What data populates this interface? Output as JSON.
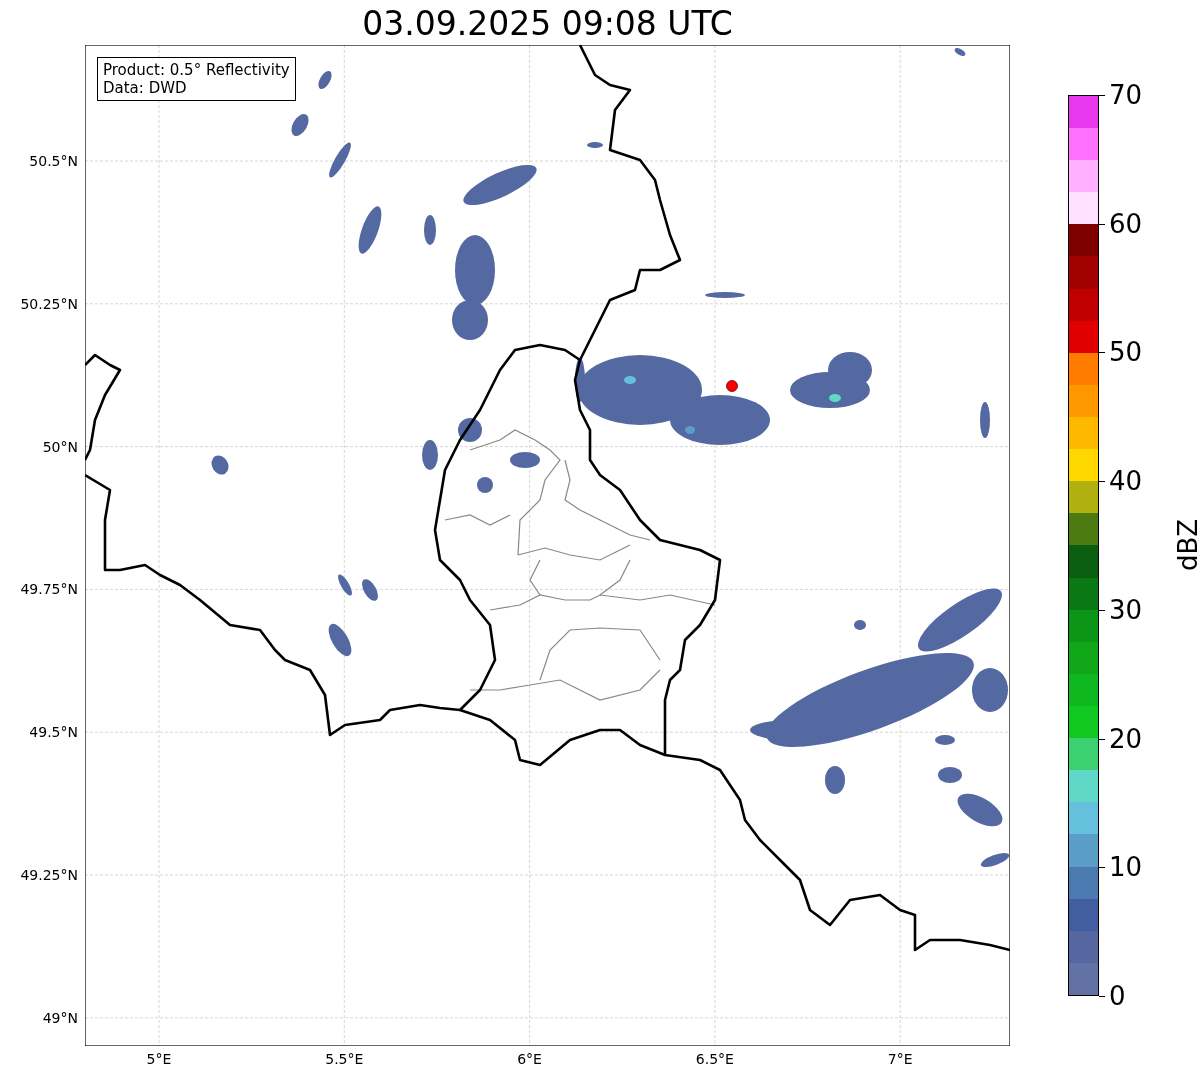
{
  "title": "03.09.2025 09:08 UTC",
  "info_box": [
    "Product: 0.5° Reflectivity",
    "Data: DWD"
  ],
  "y_ticks": [
    "50.5°N",
    "50.25°N",
    "50°N",
    "49.75°N",
    "49.5°N",
    "49.25°N",
    "49°N"
  ],
  "x_ticks": [
    "5°E",
    "5.5°E",
    "6°E",
    "6.5°E",
    "7°E"
  ],
  "colorbar": {
    "label": "dBZ",
    "ticks": [
      "70",
      "60",
      "50",
      "40",
      "30",
      "20",
      "10",
      "0"
    ],
    "segments": [
      {
        "color": "#6272a4"
      },
      {
        "color": "#5566a0"
      },
      {
        "color": "#435ea0"
      },
      {
        "color": "#4a7ab0"
      },
      {
        "color": "#5a9ec8"
      },
      {
        "color": "#64c0dc"
      },
      {
        "color": "#60d8c8"
      },
      {
        "color": "#3cd070"
      },
      {
        "color": "#10c820"
      },
      {
        "color": "#10b820"
      },
      {
        "color": "#10a818"
      },
      {
        "color": "#0c9618"
      },
      {
        "color": "#0a7814"
      },
      {
        "color": "#0a5e10"
      },
      {
        "color": "#4a7a10"
      },
      {
        "color": "#b0b010"
      },
      {
        "color": "#ffd800"
      },
      {
        "color": "#ffb800"
      },
      {
        "color": "#ff9800"
      },
      {
        "color": "#ff7c00"
      },
      {
        "color": "#e00000"
      },
      {
        "color": "#c00000"
      },
      {
        "color": "#a00000"
      },
      {
        "color": "#800000"
      },
      {
        "color": "#ffe0ff"
      },
      {
        "color": "#ffb0ff"
      },
      {
        "color": "#ff70ff"
      },
      {
        "color": "#e838ee"
      }
    ]
  }
}
